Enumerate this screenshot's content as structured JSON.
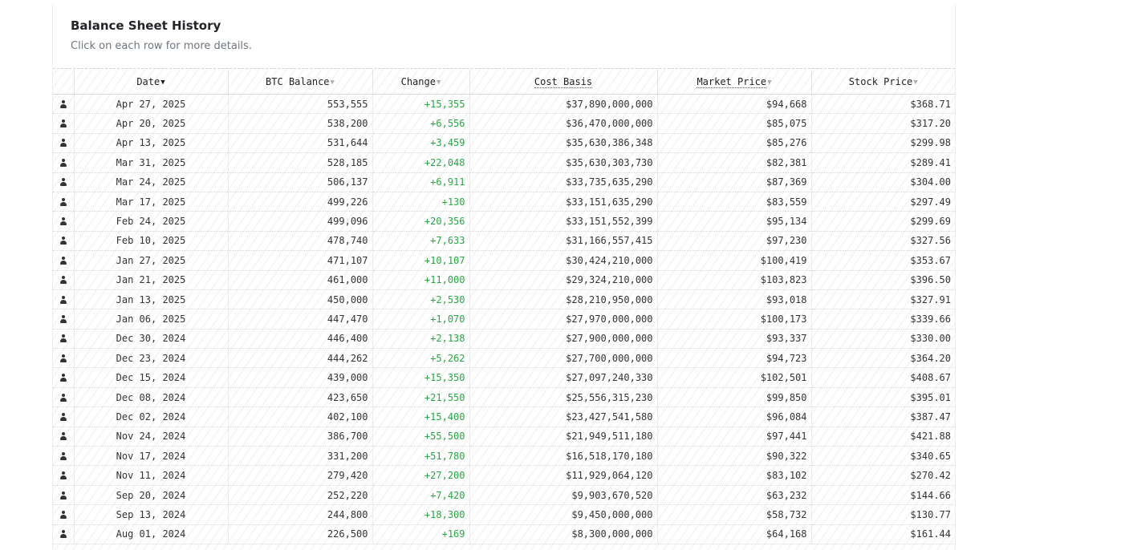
{
  "card": {
    "title": "Balance Sheet History",
    "subtitle": "Click on each row for more details."
  },
  "table": {
    "columns": {
      "date": "Date",
      "btc_balance": "BTC Balance",
      "change": "Change",
      "cost_basis": "Cost Basis",
      "market_price": "Market Price",
      "stock_price": "Stock Price"
    },
    "sort": {
      "column": "date",
      "direction": "desc"
    },
    "rows": [
      {
        "date": "Apr 27, 2025",
        "btc": "553,555",
        "change": "+15,355",
        "cost": "$37,890,000,000",
        "market": "$94,668",
        "stock": "$368.71"
      },
      {
        "date": "Apr 20, 2025",
        "btc": "538,200",
        "change": "+6,556",
        "cost": "$36,470,000,000",
        "market": "$85,075",
        "stock": "$317.20"
      },
      {
        "date": "Apr 13, 2025",
        "btc": "531,644",
        "change": "+3,459",
        "cost": "$35,630,386,348",
        "market": "$85,276",
        "stock": "$299.98"
      },
      {
        "date": "Mar 31, 2025",
        "btc": "528,185",
        "change": "+22,048",
        "cost": "$35,630,303,730",
        "market": "$82,381",
        "stock": "$289.41"
      },
      {
        "date": "Mar 24, 2025",
        "btc": "506,137",
        "change": "+6,911",
        "cost": "$33,735,635,290",
        "market": "$87,369",
        "stock": "$304.00"
      },
      {
        "date": "Mar 17, 2025",
        "btc": "499,226",
        "change": "+130",
        "cost": "$33,151,635,290",
        "market": "$83,559",
        "stock": "$297.49"
      },
      {
        "date": "Feb 24, 2025",
        "btc": "499,096",
        "change": "+20,356",
        "cost": "$33,151,552,399",
        "market": "$95,134",
        "stock": "$299.69"
      },
      {
        "date": "Feb 10, 2025",
        "btc": "478,740",
        "change": "+7,633",
        "cost": "$31,166,557,415",
        "market": "$97,230",
        "stock": "$327.56"
      },
      {
        "date": "Jan 27, 2025",
        "btc": "471,107",
        "change": "+10,107",
        "cost": "$30,424,210,000",
        "market": "$100,419",
        "stock": "$353.67"
      },
      {
        "date": "Jan 21, 2025",
        "btc": "461,000",
        "change": "+11,000",
        "cost": "$29,324,210,000",
        "market": "$103,823",
        "stock": "$396.50"
      },
      {
        "date": "Jan 13, 2025",
        "btc": "450,000",
        "change": "+2,530",
        "cost": "$28,210,950,000",
        "market": "$93,018",
        "stock": "$327.91"
      },
      {
        "date": "Jan 06, 2025",
        "btc": "447,470",
        "change": "+1,070",
        "cost": "$27,970,000,000",
        "market": "$100,173",
        "stock": "$339.66"
      },
      {
        "date": "Dec 30, 2024",
        "btc": "446,400",
        "change": "+2,138",
        "cost": "$27,900,000,000",
        "market": "$93,337",
        "stock": "$330.00"
      },
      {
        "date": "Dec 23, 2024",
        "btc": "444,262",
        "change": "+5,262",
        "cost": "$27,700,000,000",
        "market": "$94,723",
        "stock": "$364.20"
      },
      {
        "date": "Dec 15, 2024",
        "btc": "439,000",
        "change": "+15,350",
        "cost": "$27,097,240,330",
        "market": "$102,501",
        "stock": "$408.67"
      },
      {
        "date": "Dec 08, 2024",
        "btc": "423,650",
        "change": "+21,550",
        "cost": "$25,556,315,230",
        "market": "$99,850",
        "stock": "$395.01"
      },
      {
        "date": "Dec 02, 2024",
        "btc": "402,100",
        "change": "+15,400",
        "cost": "$23,427,541,580",
        "market": "$96,084",
        "stock": "$387.47"
      },
      {
        "date": "Nov 24, 2024",
        "btc": "386,700",
        "change": "+55,500",
        "cost": "$21,949,511,180",
        "market": "$97,441",
        "stock": "$421.88"
      },
      {
        "date": "Nov 17, 2024",
        "btc": "331,200",
        "change": "+51,780",
        "cost": "$16,518,170,180",
        "market": "$90,322",
        "stock": "$340.65"
      },
      {
        "date": "Nov 11, 2024",
        "btc": "279,420",
        "change": "+27,200",
        "cost": "$11,929,064,120",
        "market": "$83,102",
        "stock": "$270.42"
      },
      {
        "date": "Sep 20, 2024",
        "btc": "252,220",
        "change": "+7,420",
        "cost": "$9,903,670,520",
        "market": "$63,232",
        "stock": "$144.66"
      },
      {
        "date": "Sep 13, 2024",
        "btc": "244,800",
        "change": "+18,300",
        "cost": "$9,450,000,000",
        "market": "$58,732",
        "stock": "$130.77"
      },
      {
        "date": "Aug 01, 2024",
        "btc": "226,500",
        "change": "+169",
        "cost": "$8,300,000,000",
        "market": "$64,168",
        "stock": "$161.44"
      }
    ]
  },
  "icons": {
    "row_icon": "person-icon",
    "sort_active": "caret-down-icon",
    "sort_inactive": "caret-down-icon"
  },
  "colors": {
    "change_positive": "#28a745",
    "text": "#333333",
    "title": "#212529",
    "subtitle": "#6c757d"
  }
}
